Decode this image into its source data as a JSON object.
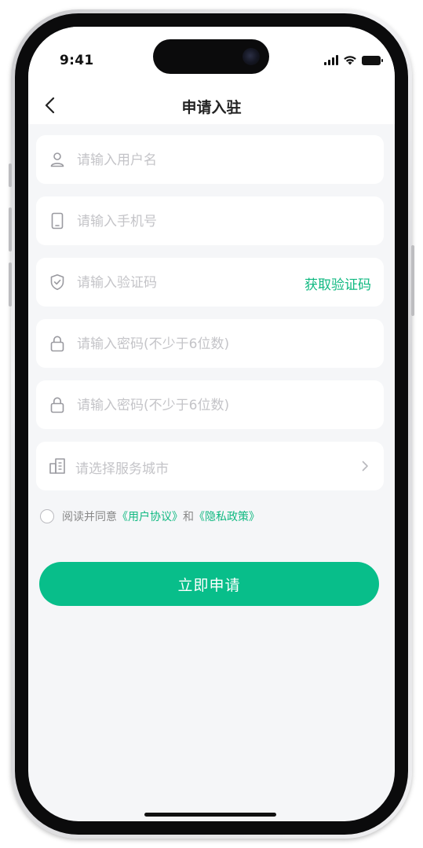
{
  "status_bar": {
    "time": "9:41"
  },
  "header": {
    "title": "申请入驻"
  },
  "form": {
    "username": {
      "placeholder": "请输入用户名",
      "icon": "user-icon"
    },
    "phone": {
      "placeholder": "请输入手机号",
      "icon": "phone-icon"
    },
    "code": {
      "placeholder": "请输入验证码",
      "icon": "shield-icon",
      "action_label": "获取验证码"
    },
    "password": {
      "placeholder": "请输入密码(不少于6位数)",
      "icon": "lock-icon"
    },
    "password_confirm": {
      "placeholder": "请输入密码(不少于6位数)",
      "icon": "lock-icon"
    },
    "city": {
      "placeholder": "请选择服务城市",
      "icon": "building-icon"
    }
  },
  "agreement": {
    "prefix": "阅读并同意",
    "user_agreement": "《用户协议》",
    "conjunction": "和",
    "privacy_policy": "《隐私政策》"
  },
  "submit": {
    "label": "立即申请"
  },
  "colors": {
    "accent": "#08be8a",
    "link": "#10b981",
    "page_bg": "#f5f6f8",
    "placeholder": "#c4c4c8"
  }
}
